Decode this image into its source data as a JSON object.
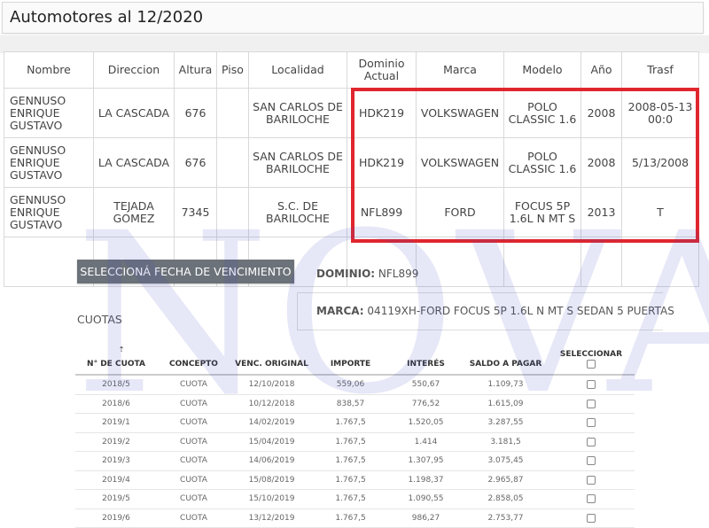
{
  "title": "Automotores al 12/2020",
  "watermark": "NOVA",
  "auto_table": {
    "headers": [
      "Nombre",
      "Direccion",
      "Altura",
      "Piso",
      "Localidad",
      "Dominio Actual",
      "Marca",
      "Modelo",
      "Año",
      "Trasf"
    ],
    "rows": [
      [
        "GENNUSO ENRIQUE GUSTAVO",
        "LA CASCADA",
        "676",
        "",
        "SAN CARLOS DE BARILOCHE",
        "HDK219",
        "VOLKSWAGEN",
        "POLO CLASSIC 1.6",
        "2008",
        "2008-05-13 00:0"
      ],
      [
        "GENNUSO ENRIQUE GUSTAVO",
        "LA CASCADA",
        "676",
        "",
        "SAN CARLOS DE BARILOCHE",
        "HDK219",
        "VOLKSWAGEN",
        "POLO CLASSIC 1.6",
        "2008",
        "5/13/2008"
      ],
      [
        "GENNUSO ENRIQUE GUSTAVO",
        "TEJADA GOMEZ",
        "7345",
        "",
        "S.C. DE BARILOCHE",
        "NFL899",
        "FORD",
        "FOCUS 5P 1.6L N MT S",
        "2013",
        "T"
      ]
    ]
  },
  "select_button": "SELECCIONÁ FECHA DE VENCIMIENTO",
  "dominio": {
    "label": "DOMINIO:",
    "value": "NFL899"
  },
  "marca": {
    "label": "MARCA:",
    "value": "04119XH-FORD FOCUS 5P 1.6L N MT S SEDAN 5 PUERTAS"
  },
  "cuotas": {
    "label": "CUOTAS",
    "headers": [
      "N° DE CUOTA",
      "CONCEPTO",
      "VENC. ORIGINAL",
      "IMPORTE",
      "INTERÉS",
      "SALDO A PAGAR",
      "SELECCIONAR"
    ],
    "rows": [
      [
        "2018/5",
        "CUOTA",
        "12/10/2018",
        "559,06",
        "550,67",
        "1.109,73"
      ],
      [
        "2018/6",
        "CUOTA",
        "10/12/2018",
        "838,57",
        "776,52",
        "1.615,09"
      ],
      [
        "2019/1",
        "CUOTA",
        "14/02/2019",
        "1.767,5",
        "1.520,05",
        "3.287,55"
      ],
      [
        "2019/2",
        "CUOTA",
        "15/04/2019",
        "1.767,5",
        "1.414",
        "3.181,5"
      ],
      [
        "2019/3",
        "CUOTA",
        "14/06/2019",
        "1.767,5",
        "1.307,95",
        "3.075,45"
      ],
      [
        "2019/4",
        "CUOTA",
        "15/08/2019",
        "1.767,5",
        "1.198,37",
        "2.965,87"
      ],
      [
        "2019/5",
        "CUOTA",
        "15/10/2019",
        "1.767,5",
        "1.090,55",
        "2.858,05"
      ],
      [
        "2019/6",
        "CUOTA",
        "13/12/2019",
        "1.767,5",
        "986,27",
        "2.753,77"
      ]
    ]
  },
  "colors": {
    "highlight": "#e0262e",
    "button": "#6c7279",
    "watermark": "#3c46be"
  }
}
